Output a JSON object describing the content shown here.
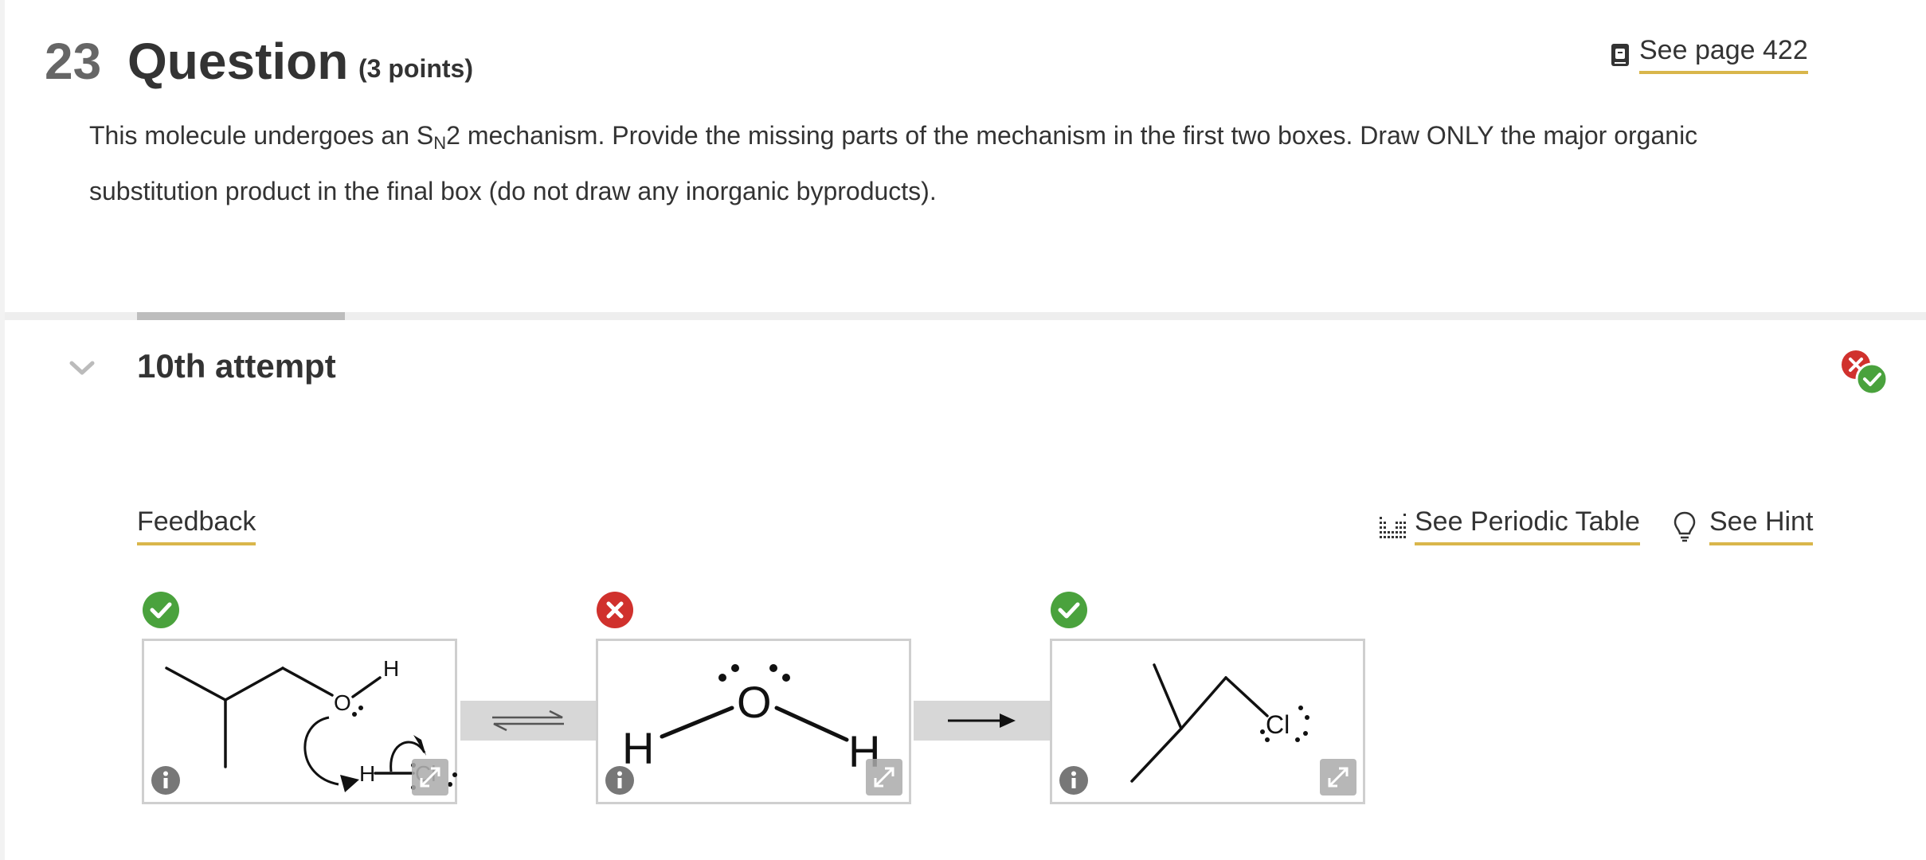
{
  "question": {
    "number": "23",
    "title": "Question",
    "points": "(3 points)",
    "see_page": "See page 422",
    "prompt_part1": "This molecule undergoes an S",
    "prompt_sub": "N",
    "prompt_part2": "2 mechanism. Provide the missing parts of the mechanism in the first two boxes.  Draw ONLY the major organic substitution product in the final box (do not draw any inorganic byproducts)."
  },
  "attempt": {
    "label": "10th attempt",
    "feedback_label": "Feedback",
    "periodic_table_label": "See Periodic Table",
    "hint_label": "See Hint"
  },
  "boxes": [
    {
      "status": "correct",
      "atoms": {
        "o": "O",
        "h_top": "H",
        "h_mid": "H",
        "cl": "Cl"
      }
    },
    {
      "status": "incorrect",
      "atoms": {
        "o": "O",
        "h_left": "H",
        "h_right": "H"
      }
    },
    {
      "status": "correct",
      "atoms": {
        "cl": "Cl"
      }
    }
  ],
  "colors": {
    "accent_underline": "#d9b64b",
    "correct": "#4aa23d",
    "incorrect": "#d0312d",
    "text": "#333333"
  }
}
